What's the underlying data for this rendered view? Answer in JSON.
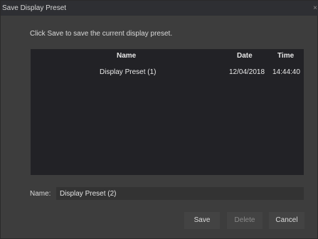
{
  "window": {
    "title": "Save Display Preset",
    "close_glyph": "×"
  },
  "instructions": "Click Save to save the current display preset.",
  "list": {
    "columns": {
      "name": "Name",
      "date": "Date",
      "time": "Time"
    },
    "rows": [
      {
        "name": "Display Preset (1)",
        "date": "12/04/2018",
        "time": "14:44:40"
      }
    ]
  },
  "name_field": {
    "label": "Name:",
    "value": "Display Preset (2)"
  },
  "buttons": {
    "save": "Save",
    "delete": "Delete",
    "cancel": "Cancel"
  },
  "colors": {
    "dialog_bg": "#3d3d3d",
    "titlebar_bg": "#2e2f33",
    "list_bg": "#222226",
    "field_bg": "#333333",
    "button_bg": "#434343",
    "disabled_text": "#8a8a8a"
  }
}
